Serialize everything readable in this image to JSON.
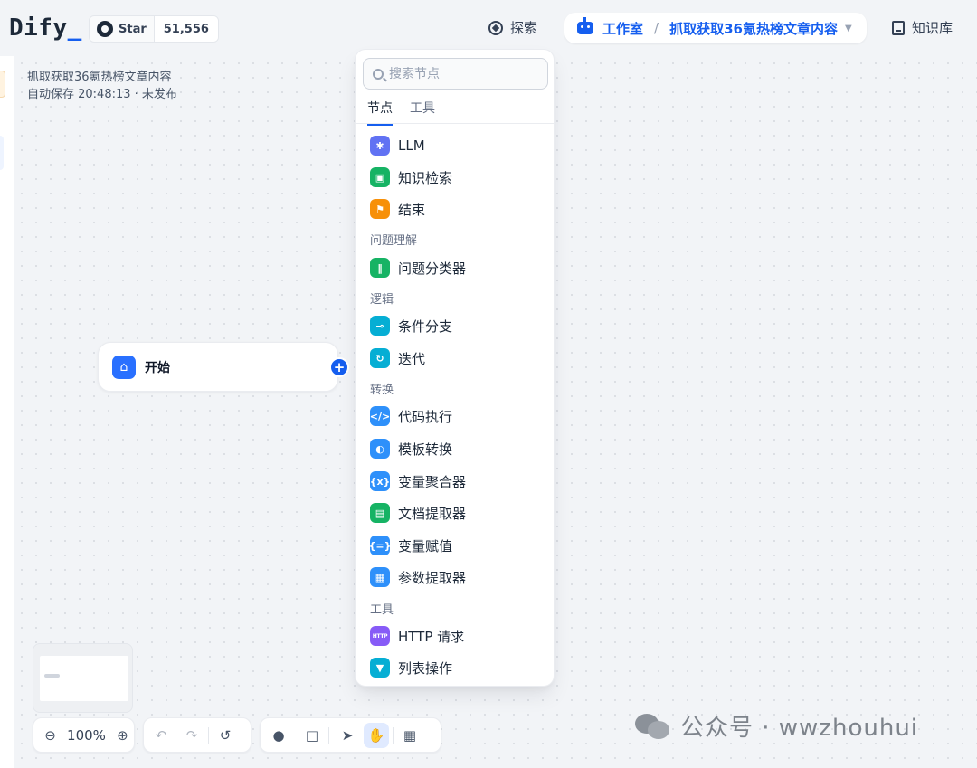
{
  "header": {
    "logo_text": "Dify",
    "logo_cursor": "_",
    "github": {
      "star_label": "Star",
      "star_count": "51,556"
    },
    "explore_label": "探索",
    "studio": {
      "label": "工作室",
      "separator": "/",
      "app_name": "抓取获取36氪热榜文章内容"
    },
    "knowledge_label": "知识库"
  },
  "app_info": {
    "name": "抓取获取36氪热榜文章内容",
    "status": "自动保存 20:48:13 · 未发布"
  },
  "start_node": {
    "label": "开始"
  },
  "node_picker": {
    "search_placeholder": "搜索节点",
    "tabs": [
      "节点",
      "工具"
    ],
    "active_tab": "节点",
    "items": {
      "llm": "LLM",
      "knowledge_retrieval": "知识检索",
      "end": "结束",
      "question_classifier": "问题分类器",
      "if_else": "条件分支",
      "iteration": "迭代",
      "code": "代码执行",
      "template": "模板转换",
      "variable_aggregator": "变量聚合器",
      "doc_extractor": "文档提取器",
      "variable_assigner": "变量赋值",
      "parameter_extractor": "参数提取器",
      "http_request": "HTTP 请求",
      "list_operator": "列表操作"
    },
    "categories": {
      "question_understanding": "问题理解",
      "logic": "逻辑",
      "transform": "转换",
      "tools": "工具"
    },
    "icon_colors": {
      "llm": "#6172f3",
      "knowledge": "#16b364",
      "end": "#f79009",
      "classifier": "#16b364",
      "logic": "#06aed4",
      "transform": "#2e90fa",
      "http": "#875bf7"
    }
  },
  "bottom_bar": {
    "zoom_level": "100%"
  },
  "watermark": {
    "text": "公众号 · wwzhouhui"
  }
}
